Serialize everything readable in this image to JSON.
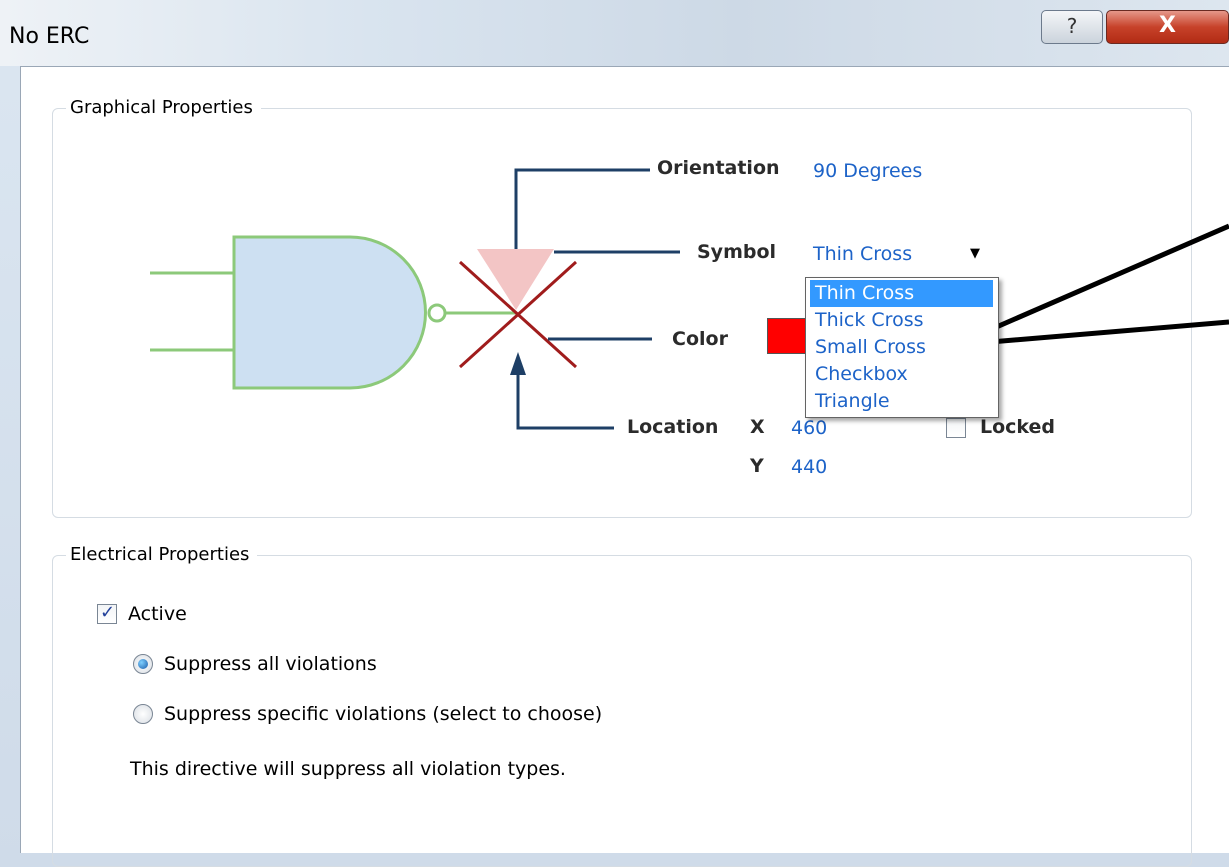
{
  "window": {
    "title": "No ERC",
    "help_button": "?",
    "close_button": "X"
  },
  "graphical": {
    "legend": "Graphical Properties",
    "orientation": {
      "label": "Orientation",
      "value": "90 Degrees"
    },
    "symbol": {
      "label": "Symbol",
      "value": "Thin Cross",
      "options": [
        "Thin Cross",
        "Thick Cross",
        "Small Cross",
        "Checkbox",
        "Triangle"
      ],
      "selected_option": "Thin Cross"
    },
    "color": {
      "label": "Color",
      "value": "#ff0000"
    },
    "location": {
      "label": "Location",
      "x_label": "X",
      "x_value": "460",
      "y_label": "Y",
      "y_value": "440",
      "locked_label": "Locked",
      "locked": false
    }
  },
  "electrical": {
    "legend": "Electrical Properties",
    "active_label": "Active",
    "active": true,
    "suppress_all_label": "Suppress all violations",
    "suppress_specific_label": "Suppress specific violations (select to choose)",
    "selected_mode": "Suppress all violations",
    "note": "This directive will suppress all violation types."
  },
  "colors": {
    "value_blue": "#1d63c8",
    "gate_fill": "#cde0f2",
    "gate_stroke": "#8cc97a",
    "cross_red": "#a01c1c",
    "leader_navy": "#1e3f66",
    "selection_blue": "#3399ff"
  }
}
